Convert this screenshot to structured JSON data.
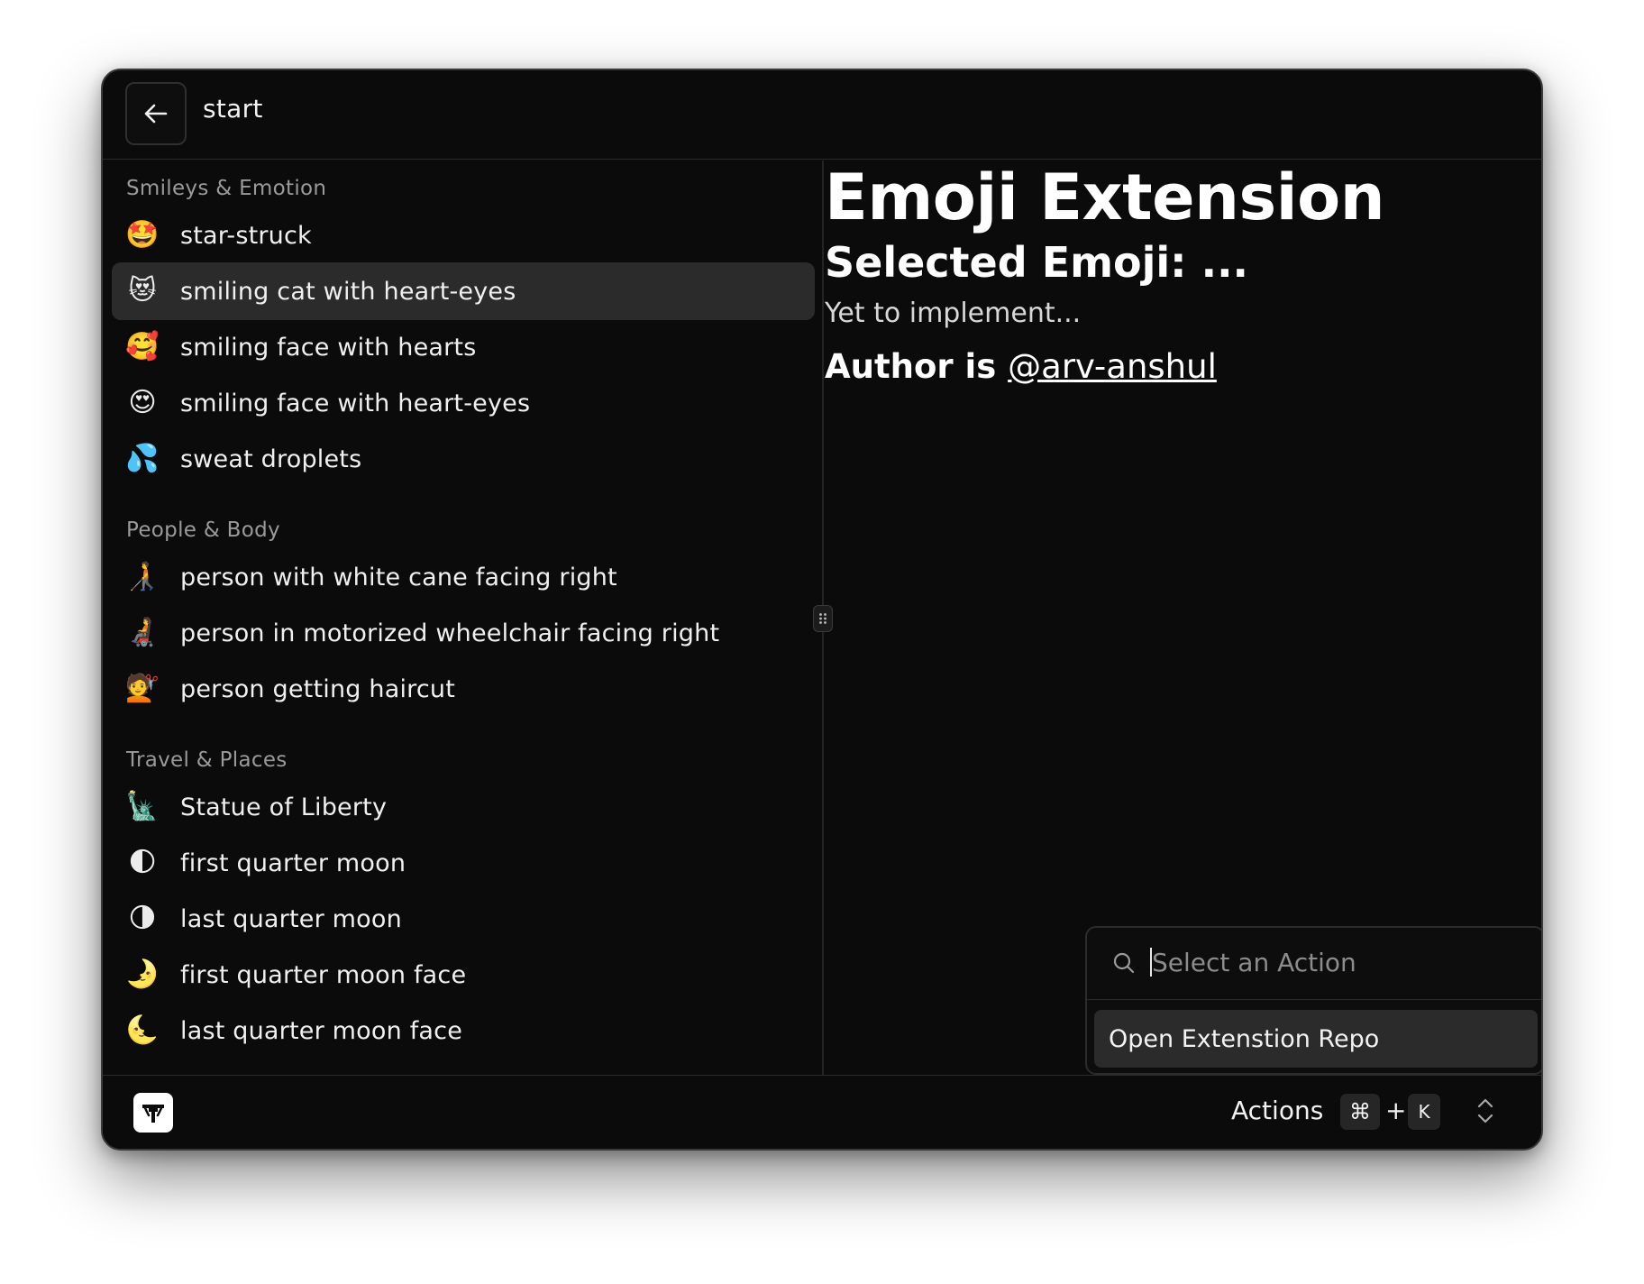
{
  "header": {
    "search_value": "start"
  },
  "sections": [
    {
      "title": "Smileys & Emotion",
      "items": [
        {
          "emoji": "🤩",
          "label": "star-struck"
        },
        {
          "emoji": "😻",
          "label": "smiling cat with heart-eyes",
          "selected": true
        },
        {
          "emoji": "🥰",
          "label": "smiling face with hearts"
        },
        {
          "emoji": "😍",
          "label": "smiling face with heart-eyes"
        },
        {
          "emoji": "💦",
          "label": "sweat droplets"
        }
      ]
    },
    {
      "title": "People & Body",
      "items": [
        {
          "emoji": "🧑‍🦯",
          "label": "person with white cane facing right"
        },
        {
          "emoji": "🧑‍🦼",
          "label": "person in motorized wheelchair facing right"
        },
        {
          "emoji": "💇",
          "label": "person getting haircut"
        }
      ]
    },
    {
      "title": "Travel & Places",
      "items": [
        {
          "emoji": "🗽",
          "label": "Statue of Liberty"
        },
        {
          "emoji": "🌓",
          "label": "first quarter moon"
        },
        {
          "emoji": "🌗",
          "label": "last quarter moon"
        },
        {
          "emoji": "🌛",
          "label": "first quarter moon face"
        },
        {
          "emoji": "🌜",
          "label": "last quarter moon face"
        }
      ]
    }
  ],
  "detail": {
    "title": "Emoji Extension",
    "subtitle": "Selected Emoji: ...",
    "note": "Yet to implement...",
    "author_prefix": "Author is ",
    "author_handle": "@arv-anshul"
  },
  "action_panel": {
    "placeholder": "Select an Action",
    "items": [
      "Open Extenstion Repo"
    ]
  },
  "footer": {
    "actions_label": "Actions",
    "shortcut_mod": "⌘",
    "shortcut_plus": "+",
    "shortcut_key": "K"
  }
}
